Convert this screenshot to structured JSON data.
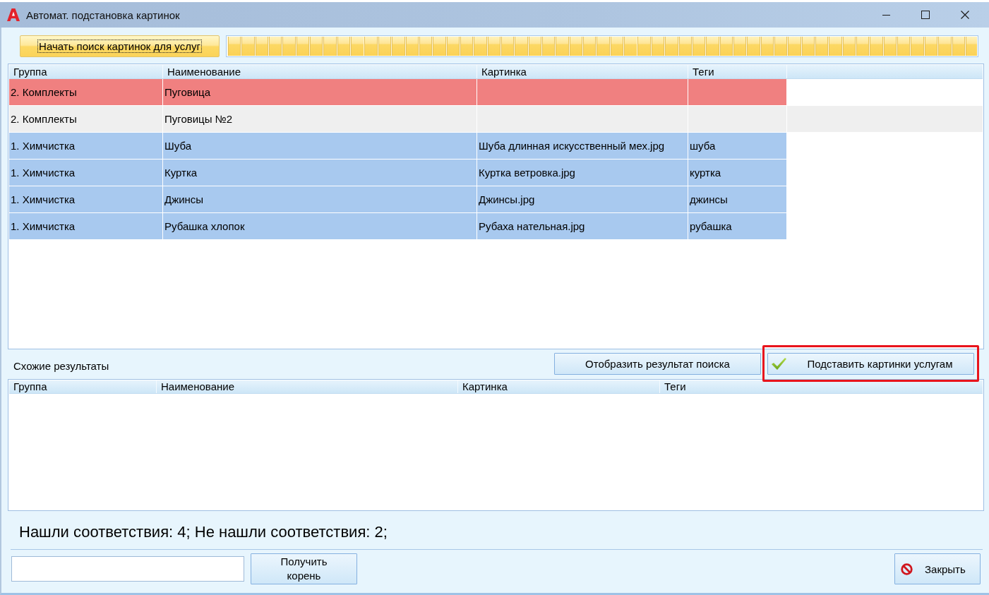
{
  "window": {
    "title": "Автомат. подстановка картинок"
  },
  "toolbar": {
    "start_button": {
      "label": "Начать поиск картинок для услуг",
      "focused": true
    },
    "progress": {
      "level": 1
    }
  },
  "main_table": {
    "columns": [
      "Группа",
      "Наименование",
      "Картинка",
      "Теги"
    ],
    "rows": [
      {
        "group": "2. Комплекты",
        "name": "Пуговица",
        "selected": false,
        "color": "#f08080"
      },
      {
        "group": "2. Комплекты",
        "name": "Пуговицы №2",
        "selected": true
      },
      {
        "group": "1. Химчистка",
        "name": "Шуба",
        "picture": "Шуба длинная искусственный мех.jpg",
        "tags": "шуба",
        "selected": false,
        "color": "#a8c9ef"
      },
      {
        "group": "1. Химчистка",
        "name": "Куртка",
        "picture": "Куртка ветровка.jpg",
        "tags": "куртка",
        "selected": false,
        "color": "#a8c9ef"
      },
      {
        "group": "1. Химчистка",
        "name": "Джинсы",
        "picture": "Джинсы.jpg",
        "tags": "джинсы",
        "selected": false,
        "color": "#a8c9ef"
      },
      {
        "group": "1. Химчистка",
        "name": "Рубашка хлопок",
        "picture": "Рубаха нательная.jpg",
        "tags": "рубашка",
        "selected": false,
        "color": "#a8c9ef"
      }
    ]
  },
  "similar_results": {
    "label": "Схожие результаты",
    "show_button": "Отобразить результат поиска",
    "apply_button": {
      "label": "Подставить картинки услугам",
      "highlighted": true
    },
    "columns": [
      "Группа",
      "Наименование",
      "Картинка",
      "Теги"
    ]
  },
  "summary": "Нашли соответствия: 4; Не нашли соответствия: 2;",
  "footer": {
    "root_button": "Получить корень",
    "close_button": "Закрыть"
  }
}
